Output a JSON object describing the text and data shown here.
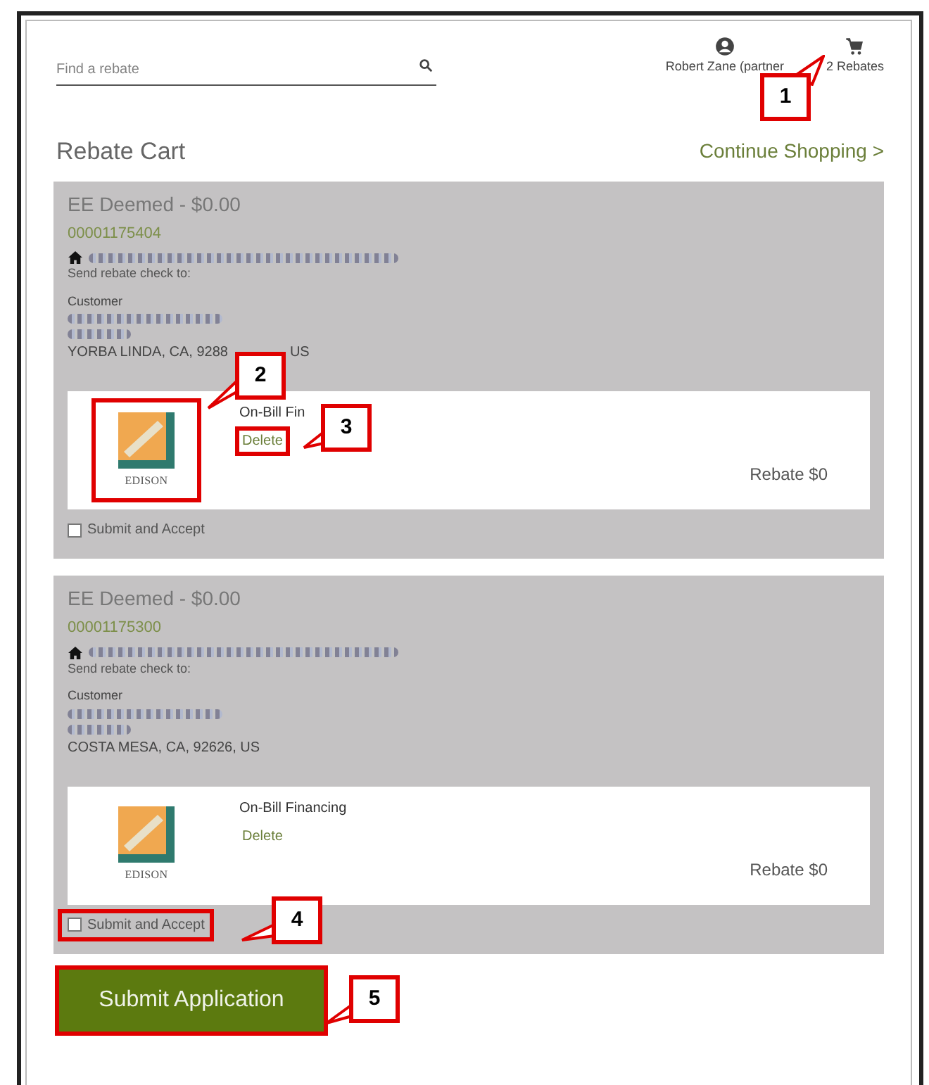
{
  "search": {
    "placeholder": "Find a rebate"
  },
  "user": {
    "name": "Robert Zane (partner"
  },
  "cart": {
    "label": "2 Rebates"
  },
  "page_title": "Rebate Cart",
  "continue_link": "Continue Shopping >",
  "items": [
    {
      "title": "EE Deemed - $0.00",
      "number": "00001175404",
      "send_label": "Send rebate check to:",
      "customer_label": "Customer",
      "address_parts": [
        "YORBA LINDA, CA, 9288",
        "US"
      ],
      "product": {
        "logo_text": "EDISON",
        "logo_highlighted": true,
        "name": "On-Bill Fin",
        "delete": "Delete",
        "delete_highlighted": true,
        "rebate": "Rebate $0"
      },
      "accept": {
        "label": "Submit and Accept",
        "checked": false,
        "highlighted": false
      }
    },
    {
      "title": "EE Deemed - $0.00",
      "number": "00001175300",
      "send_label": "Send rebate check to:",
      "customer_label": "Customer",
      "address_parts": [
        "COSTA MESA, CA, 92626, US"
      ],
      "product": {
        "logo_text": "EDISON",
        "logo_highlighted": false,
        "name": "On-Bill Financing",
        "delete": "Delete",
        "delete_highlighted": false,
        "rebate": "Rebate $0"
      },
      "accept": {
        "label": "Submit and Accept",
        "checked": false,
        "highlighted": true
      }
    }
  ],
  "submit": {
    "label": "Submit Application",
    "highlighted": true
  },
  "callouts": [
    {
      "number": "1"
    },
    {
      "number": "2"
    },
    {
      "number": "3"
    },
    {
      "number": "4"
    },
    {
      "number": "5"
    }
  ]
}
